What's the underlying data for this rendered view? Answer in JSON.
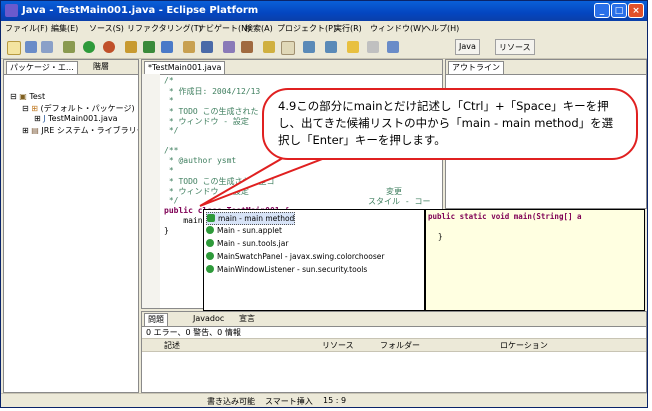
{
  "window": {
    "title": "Java - TestMain001.java - Eclipse Platform"
  },
  "menu": [
    "ファイル(F)",
    "編集(E)",
    "ソース(S)",
    "リファクタリング(T)",
    "ナビゲート(N)",
    "検索(A)",
    "プロジェクト(P)",
    "実行(R)",
    "ウィンドウ(W)",
    "ヘルプ(H)"
  ],
  "perspectives": {
    "java": "Java",
    "resource": "リソース"
  },
  "package_explorer": {
    "tabs": [
      "パッケージ・エ…",
      "階層"
    ],
    "tree": [
      "Test",
      "(デフォルト・パッケージ)",
      "TestMain001.java",
      "JRE システム・ライブラリー ["
    ]
  },
  "editor": {
    "tab": "*TestMain001.java",
    "lines": [
      "/*",
      " * 作成日: 2004/12/13",
      " *",
      " * TODO この生成された",
      " * ウィンドウ - 設定",
      " */",
      "",
      "/**",
      " * @author ysmt",
      " *",
      " * TODO この生成された型コ",
      " * ウィンドウ - 設定",
      " */",
      "public class TestMain001 {",
      "    main",
      "}"
    ],
    "comment_tail_1": "変更",
    "comment_tail_2": "スタイル - コー"
  },
  "outline": {
    "tab": "アウトライン"
  },
  "completion": {
    "items": [
      "main - main method",
      "Main - sun.applet",
      "Main - sun.tools.jar",
      "MainSwatchPanel - javax.swing.colorchooser",
      "MainWindowListener - sun.security.tools"
    ],
    "doc_line1": "public static void main(String[] a",
    "doc_line2": "}"
  },
  "problems": {
    "tabs": [
      "問題",
      "Javadoc",
      "宣言"
    ],
    "summary": "0 エラー、0 警告、0 情報",
    "columns": [
      "記述",
      "リソース",
      "フォルダー",
      "ロケーション"
    ]
  },
  "status": {
    "write": "書き込み可能",
    "insert": "スマート挿入",
    "position": "15 : 9"
  },
  "callout": {
    "text": "4.9この部分にmainとだけ記述し「Ctrl」+「Space」キーを押し、出てきた候補リストの中から「main - main method」を選択し「Enter」キーを押します。"
  }
}
